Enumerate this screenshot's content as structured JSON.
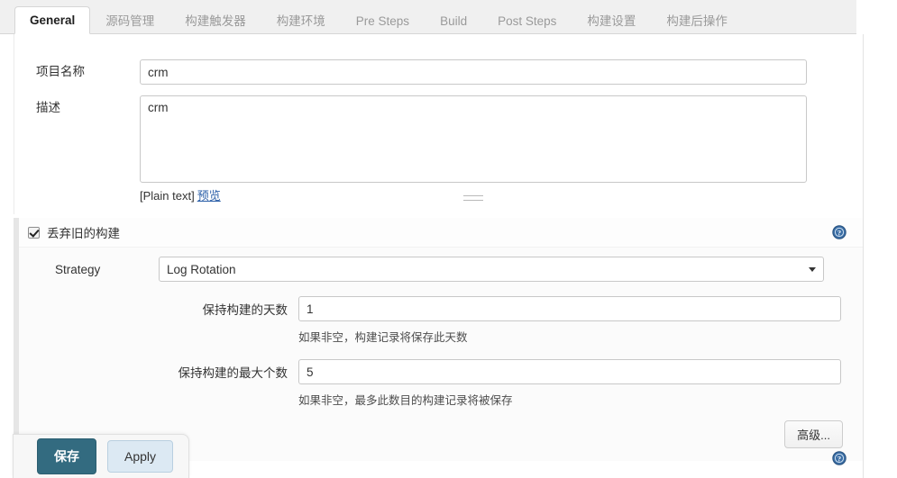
{
  "tabs": [
    {
      "label": "General",
      "active": true
    },
    {
      "label": "源码管理",
      "active": false
    },
    {
      "label": "构建触发器",
      "active": false
    },
    {
      "label": "构建环境",
      "active": false
    },
    {
      "label": "Pre Steps",
      "active": false
    },
    {
      "label": "Build",
      "active": false
    },
    {
      "label": "Post Steps",
      "active": false
    },
    {
      "label": "构建设置",
      "active": false
    },
    {
      "label": "构建后操作",
      "active": false
    }
  ],
  "form": {
    "project_name_label": "项目名称",
    "project_name_value": "crm",
    "description_label": "描述",
    "description_value": "crm",
    "plain_text_label": "[Plain text]",
    "preview_link": "预览"
  },
  "discard": {
    "checkbox_label": "丢弃旧的构建",
    "checked": true,
    "strategy_label": "Strategy",
    "strategy_value": "Log Rotation",
    "days_label": "保持构建的天数",
    "days_value": "1",
    "days_hint": "如果非空，构建记录将保存此天数",
    "max_label": "保持构建的最大个数",
    "max_value": "5",
    "max_hint": "如果非空，最多此数目的构建记录将被保存",
    "advanced_label": "高级..."
  },
  "footer": {
    "save_label": "保存",
    "apply_label": "Apply"
  },
  "icons": {
    "help": "help-icon",
    "caret": "chevron-down-icon"
  },
  "colors": {
    "accent_save": "#336b80",
    "apply_bg": "#dce9f3",
    "link": "#2b5fa8",
    "help_blue": "#3b6ea5"
  }
}
